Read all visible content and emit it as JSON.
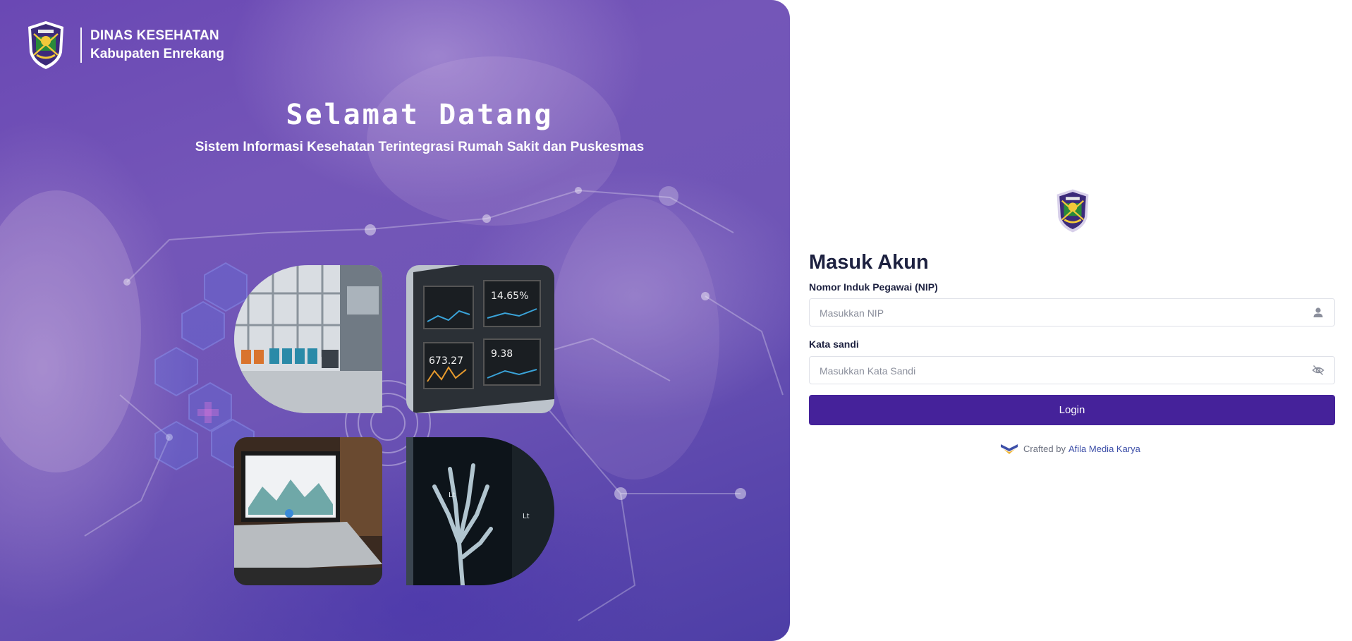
{
  "brand": {
    "title": "DINAS KESEHATAN",
    "subtitle": "Kabupaten Enrekang",
    "crest_icon": "regency-crest-icon"
  },
  "hero": {
    "welcome": "Selamat Datang",
    "tagline": "Sistem Informasi Kesehatan Terintegrasi Rumah Sakit dan Puskesmas",
    "photos": [
      "hospital-waiting-room",
      "health-dashboard-screens",
      "laptop-analytics",
      "xray-hand"
    ]
  },
  "login": {
    "title": "Masuk Akun",
    "nip_label": "Nomor Induk Pegawai (NIP)",
    "nip_placeholder": "Masukkan NIP",
    "nip_value": "",
    "nip_icon": "user-icon",
    "password_label": "Kata sandi",
    "password_placeholder": "Masukkan Kata Sandi",
    "password_value": "",
    "password_icon": "eye-off-icon",
    "button_label": "Login"
  },
  "footer": {
    "crafted_prefix": "Crafted by",
    "crafted_link": "Afila Media Karya",
    "logo_icon": "afila-logo-icon"
  },
  "colors": {
    "accent": "#45229a",
    "hero_base": "#6a48b4",
    "link": "#3d4fa8",
    "title_text": "#1d2140"
  }
}
